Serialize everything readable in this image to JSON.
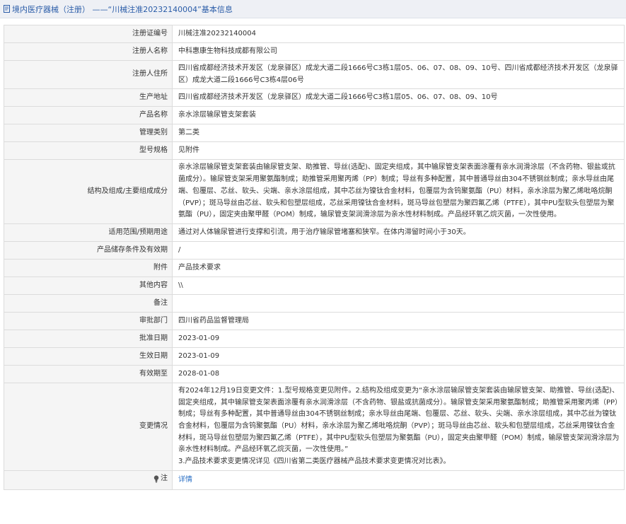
{
  "header": {
    "title": "境内医疗器械（注册） ——“川械注准20232140004”基本信息"
  },
  "rows": [
    {
      "label": "注册证编号",
      "value": "川械注准20232140004"
    },
    {
      "label": "注册人名称",
      "value": "中科惠康生物科技成都有限公司"
    },
    {
      "label": "注册人住所",
      "value": "四川省成都经济技术开发区（龙泉驿区）成龙大道二段1666号C3栋1层05、06、07、08、09、10号、四川省成都经济技术开发区（龙泉驿区）成龙大道二段1666号C3栋4层06号"
    },
    {
      "label": "生产地址",
      "value": "四川省成都经济技术开发区（龙泉驿区）成龙大道二段1666号C3栋1层05、06、07、08、09、10号"
    },
    {
      "label": "产品名称",
      "value": "亲水涂层输尿管支架套装"
    },
    {
      "label": "管理类别",
      "value": "第二类"
    },
    {
      "label": "型号规格",
      "value": "见附件"
    },
    {
      "label": "结构及组成/主要组成成分",
      "value": "亲水涂层输尿管支架套装由输尿管支架、助推管、导丝(选配)、固定夹组成，其中输尿管支架表面涂覆有亲水润滑涂层（不含药物、银盐或抗菌成分）。输尿管支架采用聚氨酯制成；助推管采用聚丙烯（PP）制成；导丝有多种配置，其中普通导丝由304不锈钢丝制成；亲水导丝由尾端、包覆层、芯丝、软头、尖端、亲水涂层组成，其中芯丝为镍钛合金材料，包覆层为含钨聚氨酯（PU）材料，亲水涂层为聚乙烯吡咯烷酮（PVP）；斑马导丝由芯丝、软头和包塑层组成，芯丝采用镍钛合金材料，斑马导丝包塑层为聚四氟乙烯（PTFE），其中PU型软头包塑层为聚氨酯（PU），固定夹由聚甲醛（POM）制成，输尿管支架润滑涂层为亲水性材料制成。产品经环氧乙烷灭菌，一次性使用。"
    },
    {
      "label": "适用范围/预期用途",
      "value": "通过对人体输尿管进行支撑和引流，用于治疗输尿管堵塞和狭窄。在体内滞留时间小于30天。"
    },
    {
      "label": "产品储存条件及有效期",
      "value": "/"
    },
    {
      "label": "附件",
      "value": "产品技术要求"
    },
    {
      "label": "其他内容",
      "value": "\\\\"
    },
    {
      "label": "备注",
      "value": ""
    },
    {
      "label": "审批部门",
      "value": "四川省药品监督管理局"
    },
    {
      "label": "批准日期",
      "value": "2023-01-09"
    },
    {
      "label": "生效日期",
      "value": "2023-01-09"
    },
    {
      "label": "有效期至",
      "value": "2028-01-08"
    },
    {
      "label": "变更情况",
      "value": "有2024年12月19日变更文件：1.型号规格变更见附件。2.结构及组成变更为“亲水涂层输尿管支架套装由输尿管支架、助推管、导丝(选配)、固定夹组成，其中输尿管支架表面涂覆有亲水润滑涂层（不含药物、银盐或抗菌成分）。输尿管支架采用聚氨酯制成；助推管采用聚丙烯（PP）制成；导丝有多种配置，其中普通导丝由304不锈钢丝制成；亲水导丝由尾端、包覆层、芯丝、软头、尖端、亲水涂层组成，其中芯丝为镍钛合金材料，包覆层为含钨聚氨酯（PU）材料，亲水涂层为聚乙烯吡咯烷酮（PVP）；斑马导丝由芯丝、软头和包塑层组成，芯丝采用镍钛合金材料，斑马导丝包塑层为聚四氟乙烯（PTFE），其中PU型软头包塑层为聚氨酯（PU），固定夹由聚甲醛（POM）制成，输尿管支架润滑涂层为亲水性材料制成。产品经环氧乙烷灭菌，一次性使用。”",
      "value2": "3.产品技术要求变更情况详见《四川省第二类医疗器械产品技术要求变更情况对比表》。"
    }
  ],
  "note": {
    "label": "注",
    "link": "详情",
    "icon": "lightbulb-icon"
  },
  "colors": {
    "header_bg": "#eef0f5",
    "header_text": "#2a5ca8",
    "label_bg": "#f5f5f5",
    "border": "#dcdcdc",
    "link": "#2a6fc4"
  }
}
